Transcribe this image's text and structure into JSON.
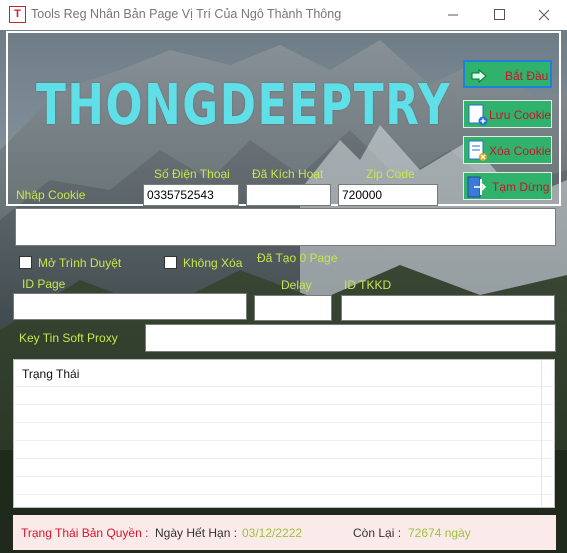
{
  "window": {
    "app_icon_letter": "T",
    "title": "Tools Reg Nhân Bản Page Vị Trí Của Ngô Thành Thông"
  },
  "header": {
    "logo_text": "THONGDEEPTRY"
  },
  "buttons": {
    "start": "Bắt Đầu",
    "save_cookie": "Lưu Cookie",
    "delete_cookie": "Xóa Cookie",
    "pause": "Tạm Dừng"
  },
  "form": {
    "cookie_label": "Nhập Cookie",
    "phone_label": "Số Điện Thoại",
    "phone_value": "0335752543",
    "activated_label": "Đã Kích Hoạt",
    "activated_value": "",
    "zip_label": "Zip Code",
    "zip_value": "720000",
    "cookie_value": "",
    "open_browser_label": "Mở Trình Duyệt",
    "no_delete_label": "Không Xóa",
    "created_label": "Đã Tạo 0 Page",
    "id_page_label": "ID Page",
    "id_page_value": "",
    "delay_label": "Delay",
    "delay_value": "",
    "id_tkkd_label": "ID TKKD",
    "id_tkkd_value": "",
    "proxy_label": "Key Tin Soft Proxy",
    "proxy_value": ""
  },
  "status": {
    "header": "Trạng Thái"
  },
  "footer": {
    "license_label": "Trạng Thái Bản Quyền :",
    "expiry_label": "Ngày Hết Hạn :",
    "expiry_value": "03/12/2222",
    "remaining_label": "Còn Lại :",
    "remaining_value": "72674 ngày"
  },
  "colors": {
    "logo": "#5fe0e8",
    "label_yellow": "#c8e64a",
    "button_green": "#2fb36c",
    "button_text": "#c8132b",
    "footer_red": "#d4162c"
  }
}
